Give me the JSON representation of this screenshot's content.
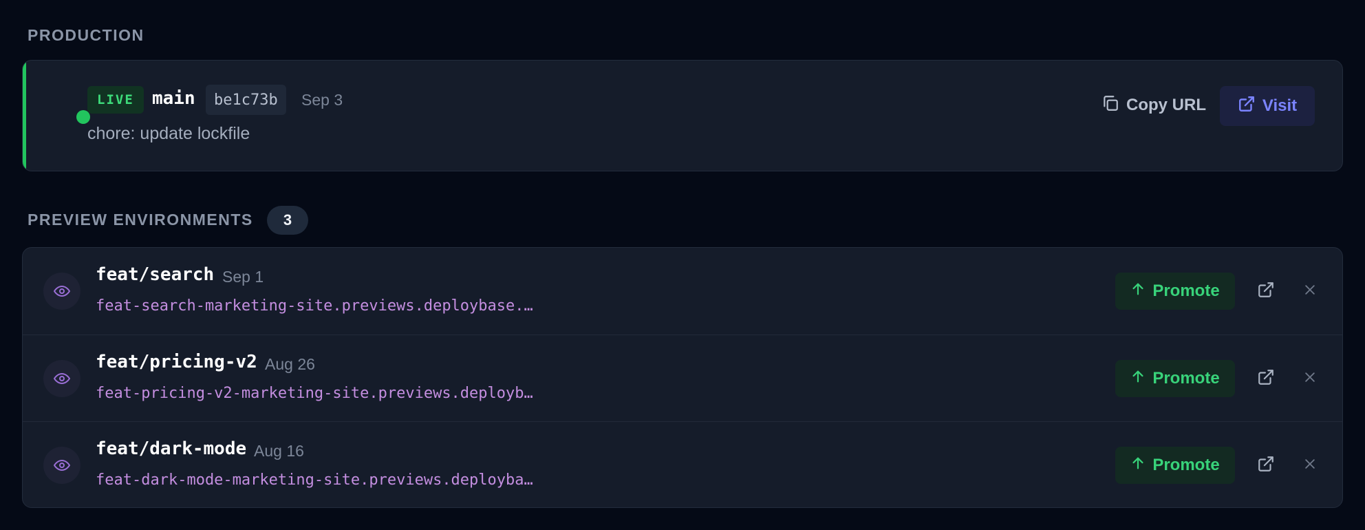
{
  "production": {
    "section_label": "PRODUCTION",
    "status_badge": "LIVE",
    "branch": "main",
    "commit": "be1c73b",
    "date": "Sep 3",
    "commit_message": "chore: update lockfile",
    "copy_url_label": "Copy URL",
    "visit_label": "Visit"
  },
  "previews": {
    "section_label": "PREVIEW ENVIRONMENTS",
    "count": "3",
    "promote_label": "Promote",
    "items": [
      {
        "branch": "feat/search",
        "date": "Sep 1",
        "url": "feat-search-marketing-site.previews.deploybase.…"
      },
      {
        "branch": "feat/pricing-v2",
        "date": "Aug 26",
        "url": "feat-pricing-v2-marketing-site.previews.deployb…"
      },
      {
        "branch": "feat/dark-mode",
        "date": "Aug 16",
        "url": "feat-dark-mode-marketing-site.previews.deployba…"
      }
    ]
  },
  "icons": {
    "status": "status-dot-icon",
    "copy": "copy-icon",
    "visit": "external-link-icon",
    "preview": "eye-icon",
    "promote": "arrow-up-icon",
    "open": "external-link-icon",
    "remove": "close-icon"
  },
  "colors": {
    "background": "#050a16",
    "card": "#151c2a",
    "live_green": "#22c55e",
    "visit_accent": "#7b84ff",
    "url_purple": "#c48ee0",
    "promote_green": "#38d37a"
  }
}
